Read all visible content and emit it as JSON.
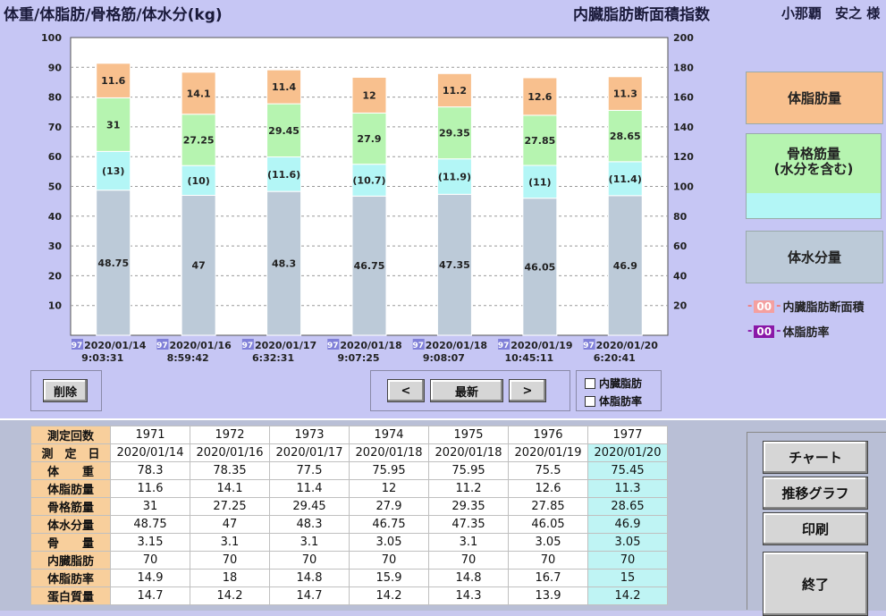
{
  "header": {
    "left_title": "体重/体脂肪/骨格筋/体水分(kg)",
    "mid_title": "内臓脂肪断面積指数",
    "user": "小那覇　安之 様"
  },
  "colors": {
    "fat": "#f8c08e",
    "muscle": "#b6f4b0",
    "bone": "#b3f6f6",
    "water": "#bccad8",
    "visceral_marker": "#f4a0a0",
    "bodyfat_marker": "#8a18a8",
    "id_tag": "#8080d8"
  },
  "chart_data": {
    "type": "bar",
    "stacked": true,
    "y_left": {
      "ticks": [
        "10",
        "20",
        "30",
        "40",
        "50",
        "60",
        "70",
        "80",
        "90",
        "100"
      ],
      "range": [
        0,
        100
      ]
    },
    "y_right": {
      "ticks": [
        "20",
        "40",
        "60",
        "80",
        "100",
        "120",
        "140",
        "160",
        "180",
        "200"
      ],
      "range": [
        0,
        200
      ]
    },
    "grid": true,
    "columns": [
      {
        "id_tag": "97",
        "date": "2020/01/14",
        "time": "9:03:31"
      },
      {
        "id_tag": "97",
        "date": "2020/01/16",
        "time": "8:59:42"
      },
      {
        "id_tag": "97",
        "date": "2020/01/17",
        "time": "6:32:31"
      },
      {
        "id_tag": "97",
        "date": "2020/01/18",
        "time": "9:07:25"
      },
      {
        "id_tag": "97",
        "date": "2020/01/18",
        "time": "9:08:07"
      },
      {
        "id_tag": "97",
        "date": "2020/01/19",
        "time": "10:45:11"
      },
      {
        "id_tag": "97",
        "date": "2020/01/20",
        "time": "6:20:41"
      }
    ],
    "series": [
      {
        "key": "water",
        "values": [
          48.75,
          47,
          48.3,
          46.75,
          47.35,
          46.05,
          46.9
        ],
        "labels": [
          "48.75",
          "47",
          "48.3",
          "46.75",
          "47.35",
          "46.05",
          "46.9"
        ]
      },
      {
        "key": "bone",
        "values": [
          13,
          10,
          11.6,
          10.7,
          11.9,
          11,
          11.4
        ],
        "labels": [
          "(13)",
          "(10)",
          "(11.6)",
          "(10.7)",
          "(11.9)",
          "(11)",
          "(11.4)"
        ]
      },
      {
        "key": "muscle",
        "values": [
          18,
          17.25,
          17.85,
          17.2,
          17.45,
          16.85,
          17.25
        ],
        "labels": [
          "31",
          "27.25",
          "29.45",
          "27.9",
          "29.35",
          "27.85",
          "28.65"
        ]
      },
      {
        "key": "fat",
        "values": [
          11.6,
          14.1,
          11.4,
          12,
          11.2,
          12.6,
          11.3
        ],
        "labels": [
          "11.6",
          "14.1",
          "11.4",
          "12",
          "11.2",
          "12.6",
          "11.3"
        ]
      }
    ]
  },
  "legend": {
    "fat": "体脂肪量",
    "muscle_l1": "骨格筋量",
    "muscle_l2": "(水分を含む)",
    "water": "体水分量",
    "visceral_mark": "00",
    "visceral_label": "内臓脂肪断面積",
    "bodyfat_mark": "00",
    "bodyfat_label": "体脂肪率"
  },
  "controls": {
    "delete": "削除",
    "prev": "<",
    "latest": "最新",
    "next": ">",
    "chk_visceral": "内臓脂肪",
    "chk_bodyfat": "体脂肪率"
  },
  "table": {
    "headers": [
      "測定回数",
      "測　定　日",
      "体　　重",
      "体脂肪量",
      "骨格筋量",
      "体水分量",
      "骨　　量",
      "内臓脂肪",
      "体脂肪率",
      "蛋白質量"
    ],
    "rows": [
      [
        "1971",
        "1972",
        "1973",
        "1974",
        "1975",
        "1976",
        "1977"
      ],
      [
        "2020/01/14",
        "2020/01/16",
        "2020/01/17",
        "2020/01/18",
        "2020/01/18",
        "2020/01/19",
        "2020/01/20"
      ],
      [
        "78.3",
        "78.35",
        "77.5",
        "75.95",
        "75.95",
        "75.5",
        "75.45"
      ],
      [
        "11.6",
        "14.1",
        "11.4",
        "12",
        "11.2",
        "12.6",
        "11.3"
      ],
      [
        "31",
        "27.25",
        "29.45",
        "27.9",
        "29.35",
        "27.85",
        "28.65"
      ],
      [
        "48.75",
        "47",
        "48.3",
        "46.75",
        "47.35",
        "46.05",
        "46.9"
      ],
      [
        "3.15",
        "3.1",
        "3.1",
        "3.05",
        "3.1",
        "3.05",
        "3.05"
      ],
      [
        "70",
        "70",
        "70",
        "70",
        "70",
        "70",
        "70"
      ],
      [
        "14.9",
        "18",
        "14.8",
        "15.9",
        "14.8",
        "16.7",
        "15"
      ],
      [
        "14.7",
        "14.2",
        "14.7",
        "14.2",
        "14.3",
        "13.9",
        "14.2"
      ]
    ]
  },
  "side": {
    "chart": "チャート",
    "trend": "推移グラフ",
    "print": "印刷",
    "exit": "終了"
  }
}
